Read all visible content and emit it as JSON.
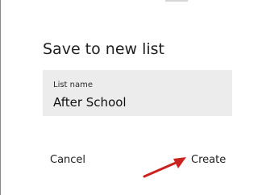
{
  "dialog": {
    "title": "Save to new list",
    "list_name_label": "List name",
    "list_name_value": "After School",
    "cancel_label": "Cancel",
    "create_label": "Create"
  },
  "annotation": {
    "icon": "arrow-icon",
    "color": "#c9221f"
  },
  "colors": {
    "field_background": "#ececec",
    "left_border": "#8a8a8a"
  }
}
